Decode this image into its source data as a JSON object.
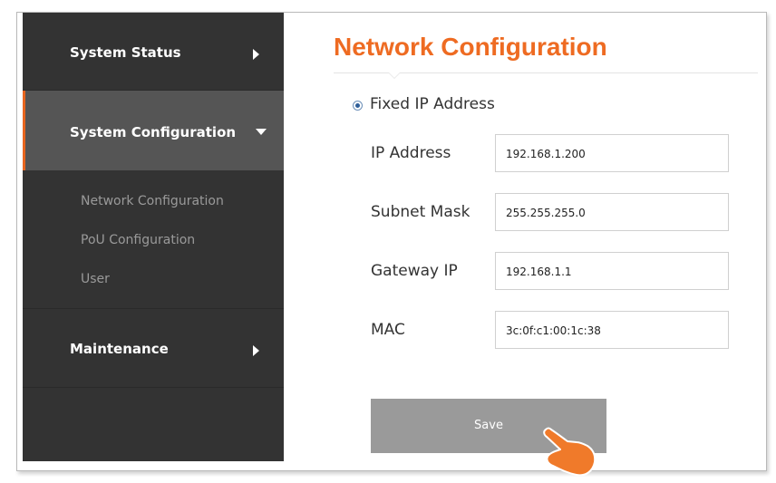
{
  "sidebar": {
    "items": [
      {
        "label": "System Status",
        "icon": "chevron-right-icon"
      },
      {
        "label": "System Configuration",
        "icon": "chevron-down-icon",
        "active": true,
        "children": [
          {
            "label": "Network Configuration"
          },
          {
            "label": "PoU Configuration"
          },
          {
            "label": "User"
          }
        ]
      },
      {
        "label": "Maintenance",
        "icon": "chevron-right-icon"
      }
    ]
  },
  "main": {
    "title": "Network Configuration",
    "mode": {
      "label": "Fixed IP Address",
      "selected": true
    },
    "fields": [
      {
        "label": "IP Address",
        "value": "192.168.1.200"
      },
      {
        "label": "Subnet Mask",
        "value": "255.255.255.0"
      },
      {
        "label": "Gateway IP",
        "value": "192.168.1.1"
      },
      {
        "label": "MAC",
        "value": "3c:0f:c1:00:1c:38"
      }
    ],
    "save_label": "Save"
  },
  "colors": {
    "accent": "#ee6b22",
    "sidebar_bg": "#333333",
    "sidebar_active_bg": "#555555",
    "button_bg": "#9a9a9a"
  },
  "icons": {
    "cursor": "pointing-hand-cursor-icon"
  }
}
